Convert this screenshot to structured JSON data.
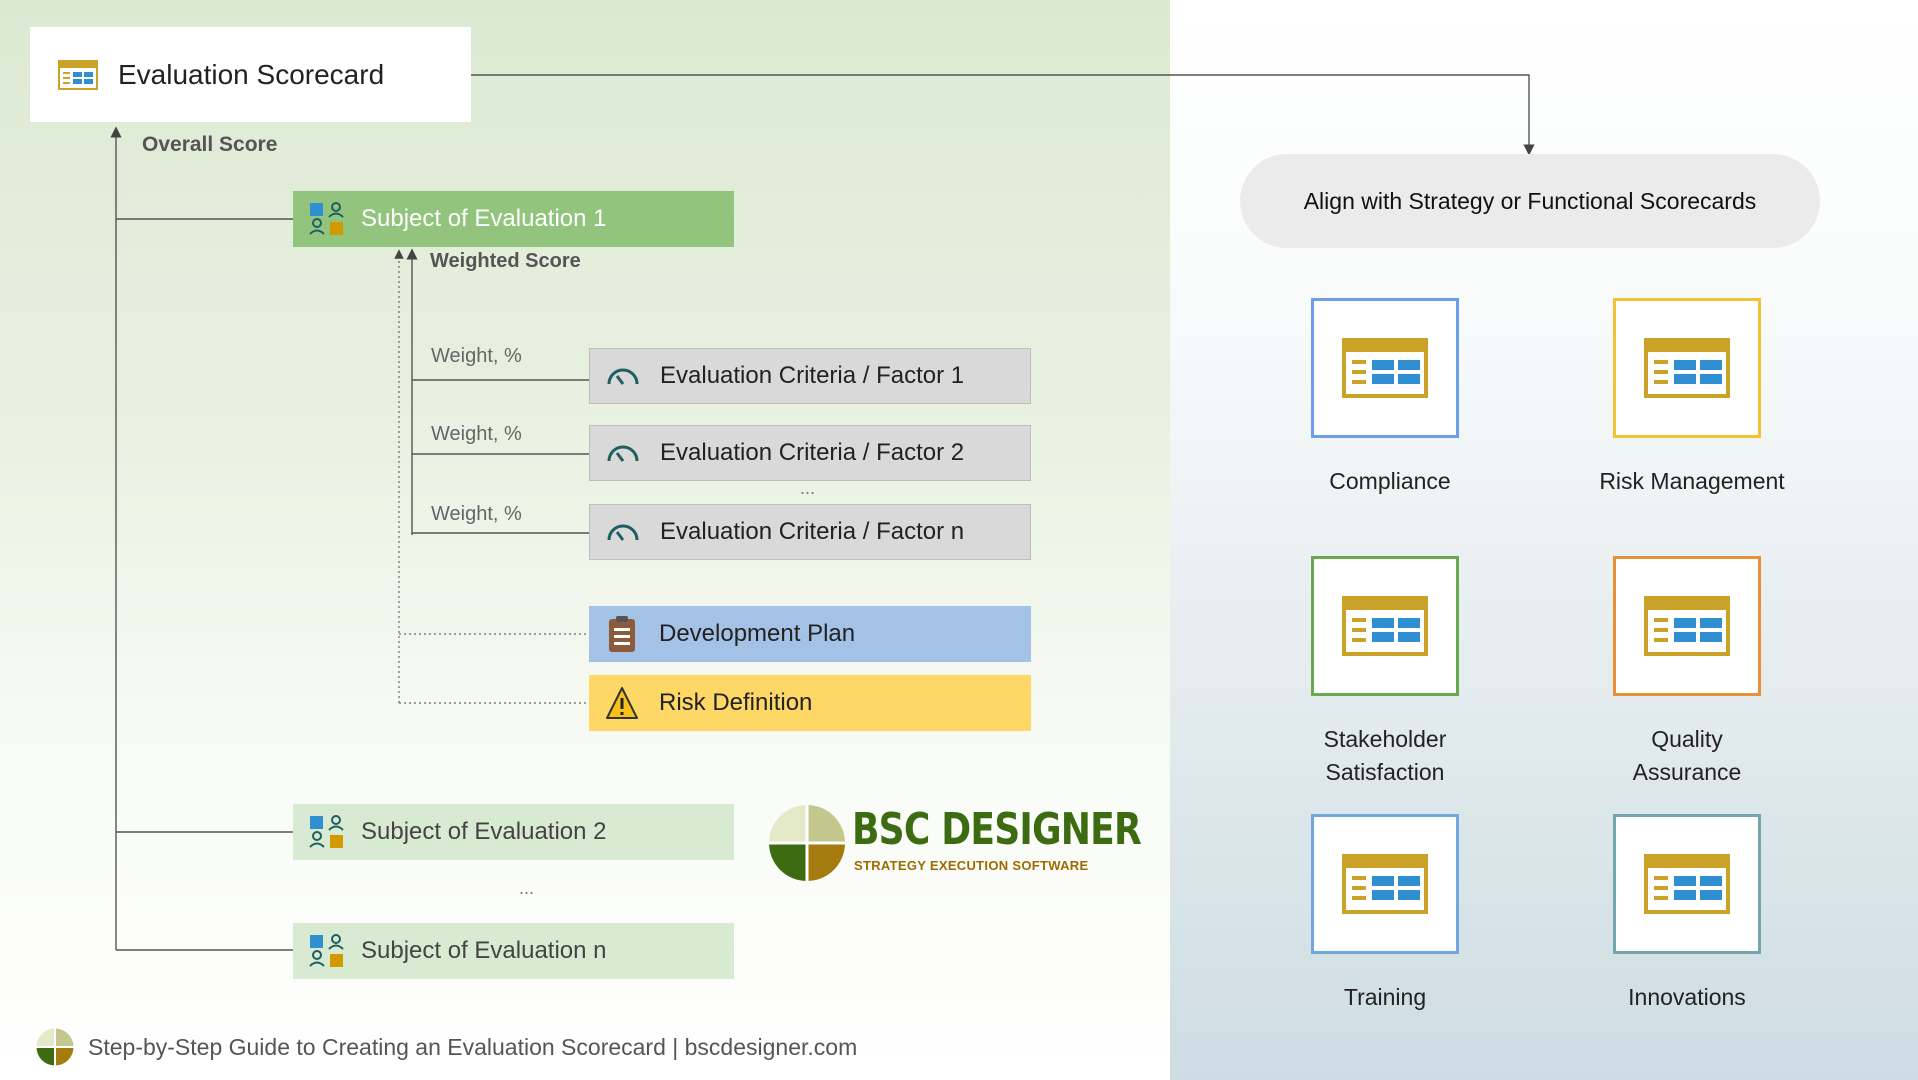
{
  "title_card": {
    "label": "Evaluation Scorecard",
    "icon": "scorecard-icon"
  },
  "labels": {
    "overall_score": "Overall Score",
    "weighted_score": "Weighted Score",
    "weight": "Weight, %",
    "ellipsis": "..."
  },
  "subjects": [
    {
      "label": "Subject of Evaluation 1",
      "icon": "subject-icon"
    },
    {
      "label": "Subject of Evaluation 2",
      "icon": "subject-icon"
    },
    {
      "label": "Subject of Evaluation n",
      "icon": "subject-icon"
    }
  ],
  "criteria": [
    {
      "label": "Evaluation Criteria / Factor 1",
      "weight_label": "Weight, %",
      "icon": "gauge-icon"
    },
    {
      "label": "Evaluation Criteria / Factor 2",
      "weight_label": "Weight, %",
      "icon": "gauge-icon"
    },
    {
      "label": "Evaluation Criteria / Factor n",
      "weight_label": "Weight, %",
      "icon": "gauge-icon"
    }
  ],
  "development_plan": {
    "label": "Development Plan",
    "icon": "clipboard-icon",
    "color": "#a4c2e6"
  },
  "risk_definition": {
    "label": "Risk Definition",
    "icon": "warning-icon",
    "color": "#fed866"
  },
  "logo": {
    "brand": "BSC DESIGNER",
    "tagline": "STRATEGY EXECUTION SOFTWARE"
  },
  "footer": {
    "text": "Step-by-Step Guide to Creating an Evaluation Scorecard | bscdesigner.com"
  },
  "align": {
    "label": "Align with Strategy or Functional Scorecards"
  },
  "scorecards": [
    {
      "label_lines": [
        "Compliance"
      ],
      "color": "#6d9eeb"
    },
    {
      "label_lines": [
        "Risk Management"
      ],
      "color": "#f1c232"
    },
    {
      "label_lines": [
        "Stakeholder",
        "Satisfaction"
      ],
      "color": "#6aa84f"
    },
    {
      "label_lines": [
        "Quality",
        "Assurance"
      ],
      "color": "#e69138"
    },
    {
      "label_lines": [
        "Training"
      ],
      "color": "#6fa8dc"
    },
    {
      "label_lines": [
        "Innovations"
      ],
      "color": "#76a5af"
    }
  ],
  "colors": {
    "subject_primary": "#93c47d",
    "subject_secondary": "#d9ead3",
    "criteria_bg": "#d9d9d9",
    "icon_gold": "#c9a227",
    "icon_blue": "#2f8fd0"
  }
}
